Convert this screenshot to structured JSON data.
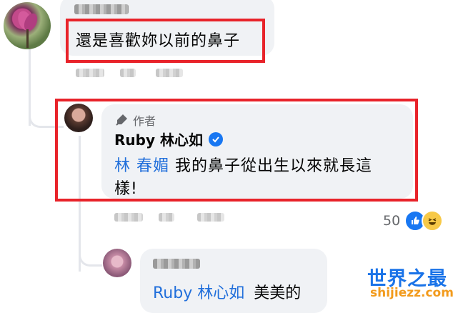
{
  "comment1": {
    "text": "還是喜歡妳以前的鼻子"
  },
  "reply1": {
    "badge": "作者",
    "author": "Ruby 林心如",
    "mention": "林 春媚",
    "text_line1": "我的鼻子從出生以來就長這",
    "text_line2": "樣!",
    "reaction_count": "50"
  },
  "reply2": {
    "mention": "Ruby 林心如",
    "text": "美美的"
  },
  "watermark": {
    "site_cn": "世界之最",
    "site_en": "shijiezz.com"
  },
  "colors": {
    "highlight_border": "#e8232a",
    "mention": "#216fdb",
    "verified": "#1877f2",
    "bubble": "#f0f2f5"
  }
}
